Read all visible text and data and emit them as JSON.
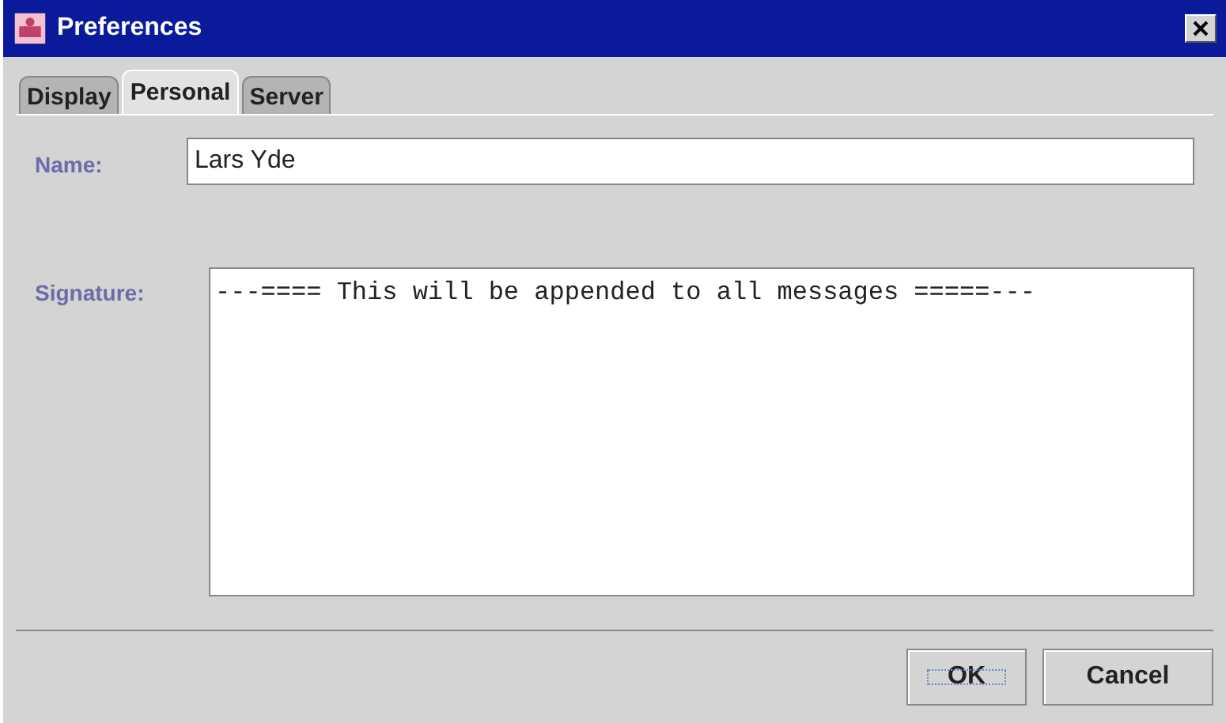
{
  "window": {
    "title": "Preferences"
  },
  "tabs": [
    {
      "label": "Display",
      "selected": false
    },
    {
      "label": "Personal",
      "selected": true
    },
    {
      "label": "Server",
      "selected": false
    }
  ],
  "name": {
    "label": "Name:",
    "value": "Lars Yde"
  },
  "signature": {
    "label": "Signature:",
    "value": "---==== This will be appended to all messages =====---"
  },
  "buttons": [
    {
      "label": "OK",
      "focused": true
    },
    {
      "label": "Cancel",
      "focused": false
    }
  ]
}
